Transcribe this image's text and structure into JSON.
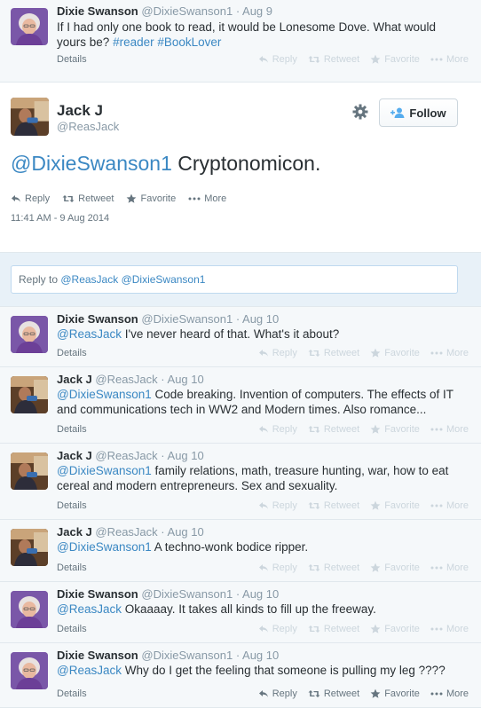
{
  "top_tweet": {
    "name": "Dixie Swanson",
    "handle": "@DixieSwanson1",
    "date": "· Aug 9",
    "text": "If I had only one book to read, it would be Lonesome Dove. What would yours be?",
    "hashtags": "#reader #BookLover",
    "details": "Details"
  },
  "actions": {
    "reply": "Reply",
    "retweet": "Retweet",
    "favorite": "Favorite",
    "more": "More"
  },
  "main_tweet": {
    "name": "Jack J",
    "handle": "@ReasJack",
    "follow_label": "Follow",
    "mention": "@DixieSwanson1",
    "text": " Cryptonomicon.",
    "timestamp": "11:41 AM - 9 Aug 2014"
  },
  "reply_box": {
    "prefix": "Reply to ",
    "mentions": "@ReasJack @DixieSwanson1"
  },
  "replies": [
    {
      "name": "Dixie Swanson",
      "handle": "@DixieSwanson1",
      "date": "· Aug 10",
      "mention": "@ReasJack",
      "text": " I've never heard of that. What's it about?",
      "details": "Details"
    },
    {
      "name": "Jack J",
      "handle": "@ReasJack",
      "date": "· Aug 10",
      "mention": "@DixieSwanson1",
      "text": " Code breaking. Invention of computers. The effects of IT and communications tech in WW2 and Modern times. Also romance...",
      "details": "Details"
    },
    {
      "name": "Jack J",
      "handle": "@ReasJack",
      "date": "· Aug 10",
      "mention": "@DixieSwanson1",
      "text": " family relations, math, treasure hunting, war, how to eat cereal and modern entrepreneurs. Sex and sexuality.",
      "details": "Details"
    },
    {
      "name": "Jack J",
      "handle": "@ReasJack",
      "date": "· Aug 10",
      "mention": "@DixieSwanson1",
      "text": " A techno-wonk bodice ripper.",
      "details": "Details"
    },
    {
      "name": "Dixie Swanson",
      "handle": "@DixieSwanson1",
      "date": "· Aug 10",
      "mention": "@ReasJack",
      "text": " Okaaaay. It takes all kinds to fill up the freeway.",
      "details": "Details"
    },
    {
      "name": "Dixie Swanson",
      "handle": "@DixieSwanson1",
      "date": "· Aug 10",
      "mention": "@ReasJack",
      "text": " Why do I get the feeling that someone is pulling my leg ????",
      "details": "Details"
    }
  ],
  "colors": {
    "link": "#3b88c3",
    "muted": "#8899a6",
    "background_gray": "#f5f8fa",
    "reply_area": "#e8f1f8"
  }
}
